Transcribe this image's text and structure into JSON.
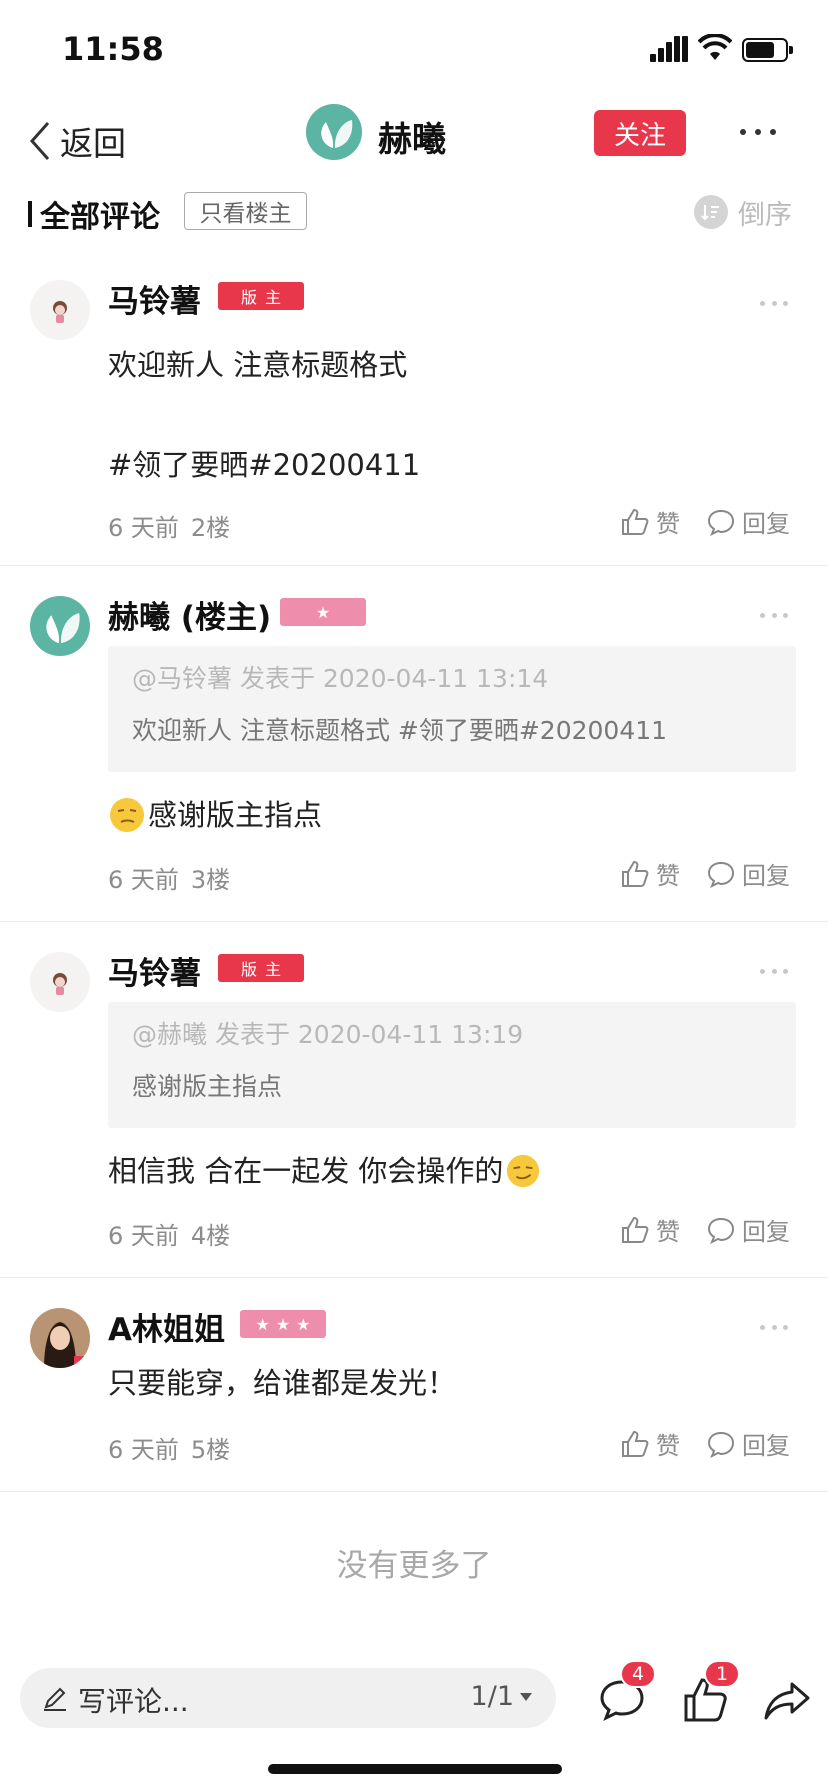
{
  "status_bar": {
    "time": "11:58"
  },
  "header": {
    "back_label": "返回",
    "title": "赫曦",
    "follow_label": "关注"
  },
  "filter": {
    "all_comments": "全部评论",
    "op_only": "只看楼主",
    "sort_label": "倒序"
  },
  "comments": [
    {
      "username": "马铃薯",
      "badge": "版主",
      "body_line1": "欢迎新人 注意标题格式",
      "body_line2": "#领了要晒#20200411",
      "time": "6 天前",
      "floor": "2楼",
      "like_label": "赞",
      "reply_label": "回复"
    },
    {
      "username": "赫曦 (楼主)",
      "badge": "★",
      "quote_meta": "@马铃薯 发表于 2020-04-11 13:14",
      "quote_text": "欢迎新人 注意标题格式 #领了要晒#20200411",
      "body": "感谢版主指点",
      "time": "6 天前",
      "floor": "3楼",
      "like_label": "赞",
      "reply_label": "回复"
    },
    {
      "username": "马铃薯",
      "badge": "版主",
      "quote_meta": "@赫曦 发表于 2020-04-11 13:19",
      "quote_text": "感谢版主指点",
      "body": "相信我 合在一起发 你会操作的",
      "time": "6 天前",
      "floor": "4楼",
      "like_label": "赞",
      "reply_label": "回复"
    },
    {
      "username": "A林姐姐",
      "badge": "★★★",
      "body": "只要能穿，给谁都是发光！",
      "time": "6 天前",
      "floor": "5楼",
      "like_label": "赞",
      "reply_label": "回复"
    }
  ],
  "no_more": "没有更多了",
  "bottom_bar": {
    "write_placeholder": "写评论...",
    "page_indicator": "1/1",
    "comment_count": "4",
    "like_count": "1"
  },
  "colors": {
    "accent_red": "#e8364b",
    "star_pink": "#ee8eac",
    "avatar_teal": "#5bb5a2"
  },
  "icons": [
    "back-chevron-icon",
    "more-icon",
    "sort-icon",
    "thumb-up-icon",
    "reply-bubble-icon",
    "pen-icon",
    "comment-icon",
    "like-icon",
    "share-icon"
  ]
}
